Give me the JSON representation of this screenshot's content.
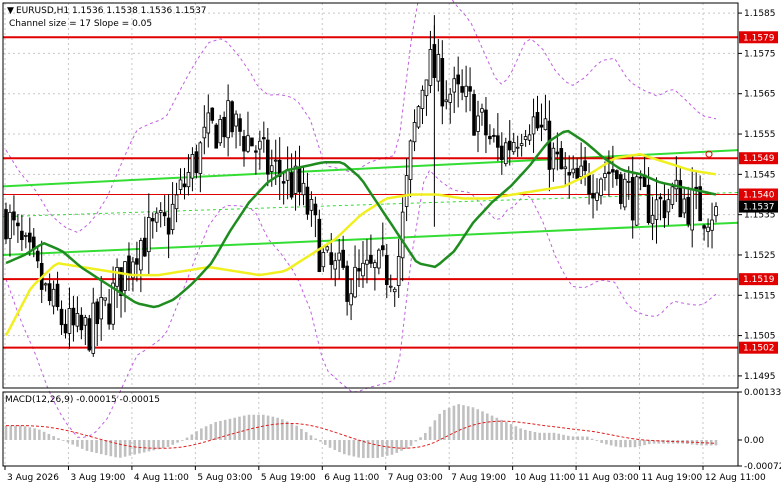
{
  "header": {
    "symbol_line": "EURUSD,H1  1.1536 1.1538 1.1536 1.1537",
    "channel_line": "Channel size = 17 Slope = 0.05",
    "dropdown_glyph": "▼"
  },
  "macd": {
    "label": "MACD(12,26,9) -0.00015 -0.00015",
    "ticks": [
      "0.00133",
      "0.00",
      "-0.00072"
    ]
  },
  "colors": {
    "background": "#ffffff",
    "grid": "#c7c7c7",
    "candle": "#000000",
    "level": "#e00000",
    "channel": "#33dd33",
    "ma_dark": "#1e8c1e",
    "ma_yellow": "#f0f020",
    "bollinger": "#c060e0",
    "macd_hist": "#c0c0c0",
    "macd_signal": "#e02020"
  },
  "chart_data": {
    "type": "candlestick",
    "symbol": "EURUSD",
    "timeframe": "H1",
    "ylim": [
      1.1492,
      1.15875
    ],
    "y_ticks": [
      "1.1585",
      "1.1575",
      "1.1565",
      "1.1555",
      "1.1545",
      "1.1535",
      "1.1525",
      "1.1515",
      "1.1505",
      "1.1495"
    ],
    "x_ticks": [
      "3 Aug 2026",
      "3 Aug 19:00",
      "4 Aug 11:00",
      "5 Aug 03:00",
      "5 Aug 19:00",
      "6 Aug 11:00",
      "7 Aug 03:00",
      "7 Aug 19:00",
      "10 Aug 11:00",
      "11 Aug 03:00",
      "11 Aug 19:00",
      "12 Aug 11:00"
    ],
    "levels": [
      {
        "label": "1.1579",
        "value": 1.1579
      },
      {
        "label": "1.1549",
        "value": 1.1549
      },
      {
        "label": "1.1519",
        "value": 1.1519
      },
      {
        "label": "1.1502",
        "value": 1.1502
      }
    ],
    "price_labels": [
      {
        "label": "1.1540",
        "value": 1.154,
        "color": "#e00000"
      },
      {
        "label": "1.1537",
        "value": 1.1537,
        "color": "#000000"
      }
    ],
    "channel": {
      "upper": [
        1.1542,
        1.1551
      ],
      "lower": [
        1.1525,
        1.1533
      ]
    },
    "anchors_close": [
      1.1535,
      1.1527,
      1.1521,
      1.1513,
      1.1508,
      1.1505,
      1.1507,
      1.1512,
      1.152,
      1.1528,
      1.153,
      1.1532,
      1.154,
      1.1548,
      1.1555,
      1.1558,
      1.1556,
      1.1553,
      1.1547,
      1.1545,
      1.1542,
      1.1535,
      1.1522,
      1.152,
      1.1518,
      1.152,
      1.1521,
      1.1522,
      1.1552,
      1.1573,
      1.1568,
      1.1564,
      1.1562,
      1.1556,
      1.155,
      1.1554,
      1.156,
      1.1555,
      1.1547,
      1.1542,
      1.1543,
      1.1546,
      1.1546,
      1.154,
      1.1538,
      1.1537,
      1.154,
      1.1538,
      1.1536,
      1.1537
    ],
    "ma_dark": [
      1.1523,
      1.1525,
      1.1528,
      1.1526,
      1.1522,
      1.1519,
      1.1516,
      1.1513,
      1.1512,
      1.1514,
      1.1518,
      1.1523,
      1.1531,
      1.1538,
      1.1543,
      1.1546,
      1.1547,
      1.1548,
      1.1548,
      1.1544,
      1.1537,
      1.153,
      1.1523,
      1.1522,
      1.1526,
      1.1533,
      1.1538,
      1.1542,
      1.1547,
      1.1553,
      1.1556,
      1.1553,
      1.1549,
      1.1546,
      1.1545,
      1.1543,
      1.1542,
      1.1541,
      1.154
    ],
    "ma_yellow": [
      1.1505,
      1.1517,
      1.1523,
      1.1522,
      1.1521,
      1.152,
      1.152,
      1.1521,
      1.1522,
      1.1521,
      1.152,
      1.1521,
      1.1525,
      1.1529,
      1.1535,
      1.1539,
      1.154,
      1.154,
      1.1539,
      1.1539,
      1.154,
      1.1541,
      1.1542,
      1.1545,
      1.1549,
      1.155,
      1.1548,
      1.1546,
      1.1545
    ]
  }
}
